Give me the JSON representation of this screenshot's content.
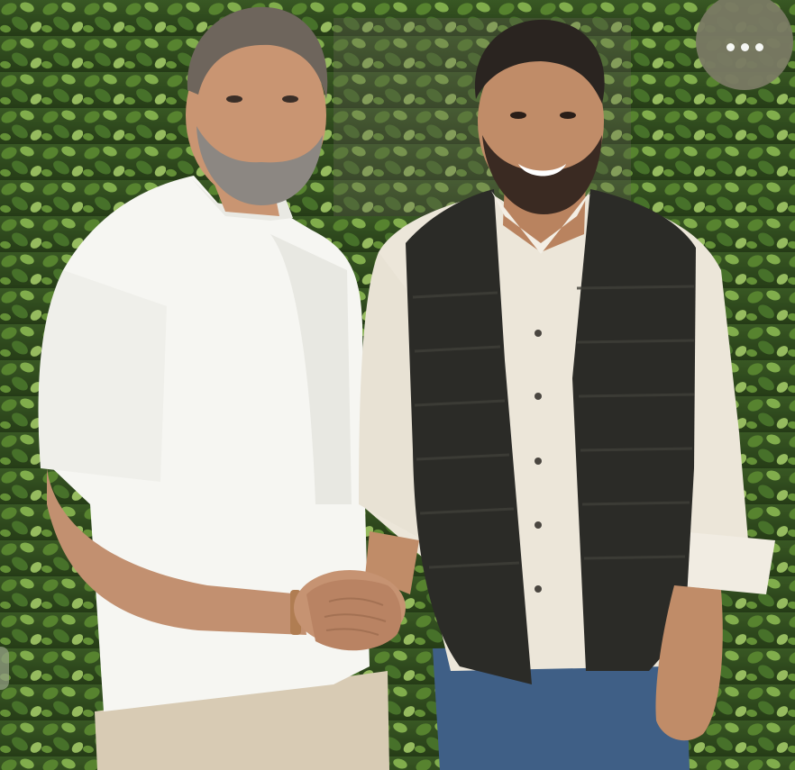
{
  "photo": {
    "description_icon": "photo-two-men-handshake",
    "colors": {
      "foliage_dark": "#2f4a1f",
      "foliage_mid": "#4d7a2e",
      "foliage_light": "#8fbf55",
      "white_shirt": "#f6f6f2",
      "khaki": "#d8cbb4",
      "cream_shirt": "#ece6d9",
      "vest": "#2b2b27",
      "jeans": "#3f5f86",
      "skin": "#c99572",
      "hair": "#2a2420",
      "grey_hair": "#8c8782"
    }
  },
  "overlay": {
    "more_button_icon": "more-horizontal-icon",
    "more_button_color": "#7a7a64"
  }
}
